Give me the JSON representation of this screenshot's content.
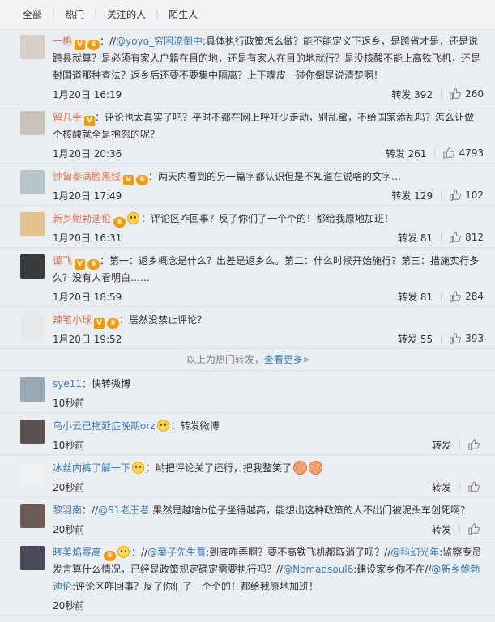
{
  "tabs": [
    "全部",
    "热门",
    "关注的人",
    "陌生人"
  ],
  "hot": [
    {
      "nick": "一格",
      "badges": [
        "V",
        "vip"
      ],
      "text_parts": [
        {
          "t": "：//"
        },
        {
          "m": "@yoyo_穷困潦倒中"
        },
        {
          "t": ":具体执行政策怎么做？能不能定义下返乡，是跨省才是，还是说跨县就算？是必须有家人户籍在目的地，还是有家人在目的地就行？是没核酸不能上高铁飞机，还是封国道那种查法？返乡后还要不要集中隔离？上下嘴皮一碰你倒是说清楚啊！"
        }
      ],
      "time": "1月20日 16:19",
      "repost": "转发 392",
      "likes": "260"
    },
    {
      "nick": "留几手",
      "badges": [
        "V"
      ],
      "text_parts": [
        {
          "t": "：评论也太真实了吧？平时不都在网上呼吁少走动，别乱窜，不给国家添乱吗？怎么让做个核酸就全是抱怨的呢？"
        }
      ],
      "time": "1月20日 20:36",
      "repost": "转发 261",
      "likes": "4793"
    },
    {
      "nick": "钟匐泰满脸黑线",
      "badges": [
        "V",
        "vip"
      ],
      "text_parts": [
        {
          "t": "：两天内看到的另一篇字都认识但是不知道在说啥的文字…"
        }
      ],
      "time": "1月20日 17:49",
      "repost": "转发 129",
      "likes": "102"
    },
    {
      "nick": "新乡鲍勃迪伦",
      "badges": [
        "vip",
        "face"
      ],
      "text_parts": [
        {
          "t": "：评论区咋回事？反了你们了一个个的！都给我原地加班！"
        }
      ],
      "time": "1月20日 16:31",
      "repost": "转发 81",
      "likes": "812"
    },
    {
      "nick": "谭飞",
      "badges": [
        "V",
        "vip"
      ],
      "text_parts": [
        {
          "t": "：第一：返乡概念是什么？出差是返乡么。第二：什么时候开始施行？第三：措施实行多久？没有人看明白……"
        }
      ],
      "time": "1月20日 18:59",
      "repost": "转发 81",
      "likes": "284"
    },
    {
      "nick": "辣笔小球",
      "badges": [
        "V",
        "vip"
      ],
      "text_parts": [
        {
          "t": "：居然没禁止评论？"
        }
      ],
      "time": "1月20日 19:52",
      "repost": "转发 55",
      "likes": "393"
    }
  ],
  "more_bar": {
    "text": "以上为热门转发，",
    "link": "查看更多»"
  },
  "recent": [
    {
      "nick": "sye11",
      "badges": [],
      "text_parts": [
        {
          "t": "：快转微博"
        }
      ],
      "time": "10秒前",
      "actions": false
    },
    {
      "nick": "乌小云已拖延症晚期orz",
      "badges": [
        "face"
      ],
      "text_parts": [
        {
          "t": "：转发微博"
        }
      ],
      "time": "10秒前",
      "actions": true
    },
    {
      "nick": "冰丝内裤了解一下",
      "badges": [
        "face"
      ],
      "text_parts": [
        {
          "t": "：哟把评论关了还行，把我整笑了"
        }
      ],
      "flowers": 2,
      "time": "20秒前",
      "actions": true
    },
    {
      "nick": "黎羽南",
      "badges": [],
      "text_parts": [
        {
          "t": "：//"
        },
        {
          "m": "@S1老王者"
        },
        {
          "t": ":果然是越啥b位子坐得越高，能想出这种政策的人不出门被泥头车创死啊？"
        }
      ],
      "time": "20秒前",
      "actions": true
    },
    {
      "nick": "晓美焰赛高",
      "badges": [
        "vip",
        "face"
      ],
      "text_parts": [
        {
          "t": "：//"
        },
        {
          "m": "@葉子先生薔"
        },
        {
          "t": ":到底咋弄啊？要不高铁飞机都取消了呗？//"
        },
        {
          "m": "@科幻光年"
        },
        {
          "t": ":监察专员发言算什么情况，已经是政策规定确定需要执行吗？//"
        },
        {
          "m": "@Nomadsoul6"
        },
        {
          "t": ":建设家乡你不在//"
        },
        {
          "m": "@新乡鲍勃迪伦"
        },
        {
          "t": ":评论区咋回事？反了你们了一个个的！都给我原地加班！"
        }
      ],
      "time": "20秒前",
      "actions": false
    }
  ],
  "labels": {
    "repost": "转发"
  },
  "colors": {
    "nick_hot": "#eb7350",
    "nick_recent": "#3c7cbb",
    "link": "#3c7cbb",
    "badge": "#f29b0e"
  }
}
